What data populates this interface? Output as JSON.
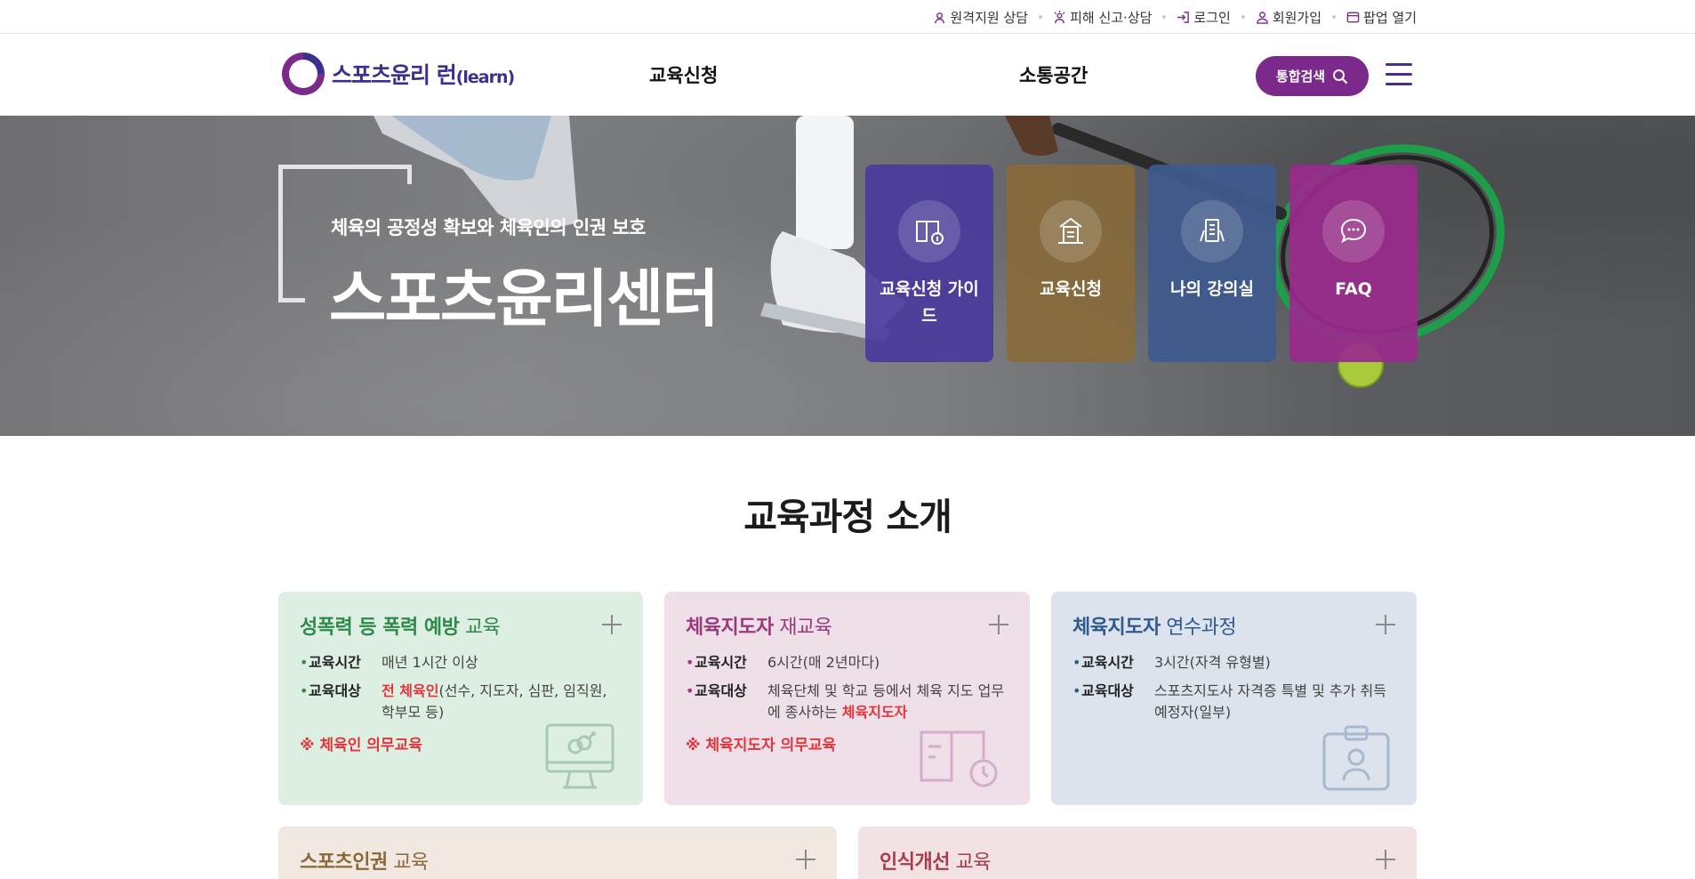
{
  "util": {
    "items": [
      {
        "label": "원격지원 상담",
        "icon": "headset-icon"
      },
      {
        "label": "피해 신고·상담",
        "icon": "alert-person-icon"
      },
      {
        "label": "로그인",
        "icon": "login-icon"
      },
      {
        "label": "회원가입",
        "icon": "person-icon"
      },
      {
        "label": "팝업 열기",
        "icon": "popup-icon"
      }
    ]
  },
  "header": {
    "logo_main": "스포츠윤리 런",
    "logo_sub": "(learn)",
    "nav": [
      "교육신청",
      "소통공간"
    ],
    "search_label": "통합검색"
  },
  "hero": {
    "subtitle": "체육의 공정성 확보와 체육인의 인권 보호",
    "title": "스포츠윤리센터",
    "quick": [
      {
        "label": "교육신청 가이드",
        "color": "#4a3a9c",
        "icon": "guide-book-icon"
      },
      {
        "label": "교육신청",
        "color": "#8a6a3a",
        "icon": "application-icon"
      },
      {
        "label": "나의 강의실",
        "color": "#3e5a8e",
        "icon": "classroom-icon"
      },
      {
        "label": "FAQ",
        "color": "#9a2a8c",
        "icon": "chat-bubble-icon"
      }
    ]
  },
  "section": {
    "title": "교육과정 소개"
  },
  "cards": [
    {
      "title_bold": "성폭력 등 폭력 예방",
      "title_light": " 교육",
      "title_color": "#2e8a4a",
      "bg": "#dcefe2",
      "rows": [
        {
          "label": "교육시간",
          "value": "매년 1시간 이상"
        },
        {
          "label": "교육대상",
          "value_red": "전 체육인",
          "value": "(선수, 지도자, 심판, 임직원, 학부모 등)"
        }
      ],
      "note": "※ 체육인 의무교육"
    },
    {
      "title_bold": "체육지도자",
      "title_light": " 재교육",
      "title_color": "#9a3a7c",
      "bg": "#efdfe9",
      "rows": [
        {
          "label": "교육시간",
          "value": "6시간(매 2년마다)"
        },
        {
          "label": "교육대상",
          "value": "체육단체 및 학교 등에서 체육 지도 업무에 종사하는 ",
          "value_red_after": "체육지도자"
        }
      ],
      "note": "※ 체육지도자 의무교육"
    },
    {
      "title_bold": "체육지도자",
      "title_light": " 연수과정",
      "title_color": "#2e5a8e",
      "bg": "#dde3ed",
      "rows": [
        {
          "label": "교육시간",
          "value": "3시간(자격 유형별)"
        },
        {
          "label": "교육대상",
          "value": "스포츠지도사 자격증 특별 및 추가 취득 예정자(일부)"
        }
      ],
      "note": ""
    },
    {
      "title_bold": "스포츠인권",
      "title_light": " 교육",
      "title_color": "#8a6a3a",
      "bg": "#f1e8e2"
    },
    {
      "title_bold": "인식개선",
      "title_light": " 교육",
      "title_color": "#a83a4a",
      "bg": "#f2e2e4"
    }
  ]
}
